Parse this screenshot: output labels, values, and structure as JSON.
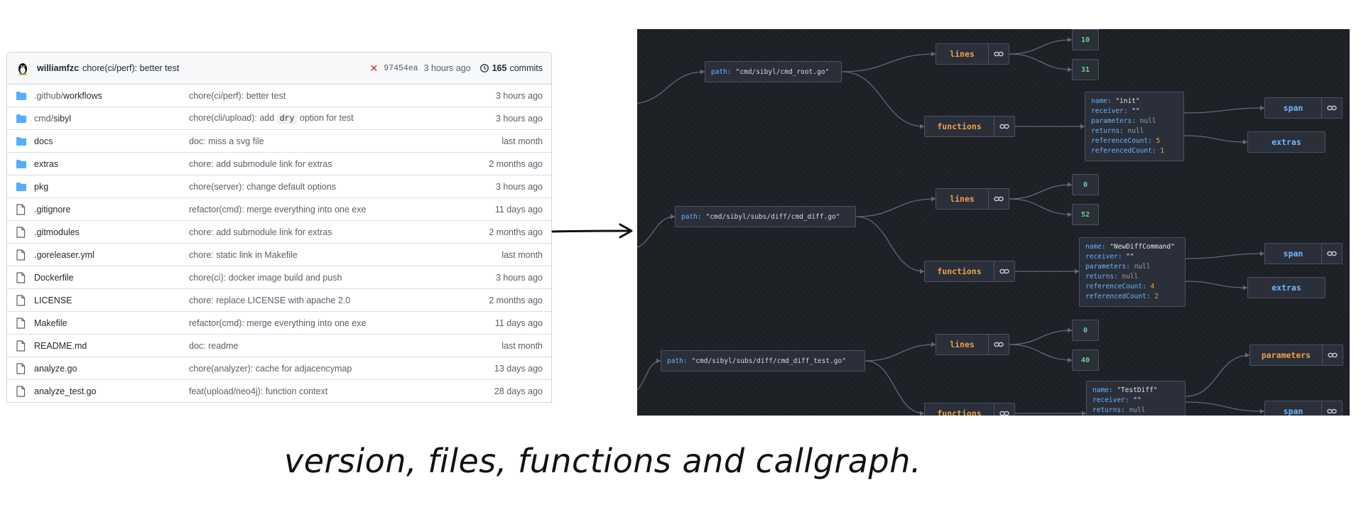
{
  "repo": {
    "latest_commit": {
      "author": "williamfzc",
      "message": "chore(ci/perf): better test",
      "status_icon": "x-icon",
      "sha": "97454ea",
      "time": "3 hours ago",
      "commits_count": "165",
      "commits_label": "commits"
    },
    "files": [
      {
        "type": "folder",
        "name_dim": ".github/",
        "name": "workflows",
        "message": "chore(ci/perf): better test",
        "time": "3 hours ago"
      },
      {
        "type": "folder",
        "name_dim": "cmd/",
        "name": "sibyl",
        "message": "chore(cli/upload): add ",
        "code": "dry",
        "message_after": " option for test",
        "time": "3 hours ago"
      },
      {
        "type": "folder",
        "name": "docs",
        "message": "doc: miss a svg file",
        "time": "last month"
      },
      {
        "type": "folder",
        "name": "extras",
        "message": "chore: add submodule link for extras",
        "time": "2 months ago"
      },
      {
        "type": "folder",
        "name": "pkg",
        "message": "chore(server): change default options",
        "time": "3 hours ago"
      },
      {
        "type": "file",
        "name": ".gitignore",
        "message": "refactor(cmd): merge everything into one exe",
        "time": "11 days ago"
      },
      {
        "type": "file",
        "name": ".gitmodules",
        "message": "chore: add submodule link for extras",
        "time": "2 months ago"
      },
      {
        "type": "file",
        "name": ".goreleaser.yml",
        "message": "chore: static link in Makefile",
        "time": "last month"
      },
      {
        "type": "file",
        "name": "Dockerfile",
        "message": "chore(ci): docker image build and push",
        "time": "3 hours ago"
      },
      {
        "type": "file",
        "name": "LICENSE",
        "message": "chore: replace LICENSE with apache 2.0",
        "time": "2 months ago"
      },
      {
        "type": "file",
        "name": "Makefile",
        "message": "refactor(cmd): merge everything into one exe",
        "time": "11 days ago"
      },
      {
        "type": "file",
        "name": "README.md",
        "message": "doc: readme",
        "time": "last month"
      },
      {
        "type": "file",
        "name": "analyze.go",
        "message": "chore(analyzer): cache for adjacencymap",
        "time": "13 days ago"
      },
      {
        "type": "file",
        "name": "analyze_test.go",
        "message": "feat(upload/neo4j): function context",
        "time": "28 days ago"
      }
    ]
  },
  "graph": {
    "path_key": "path:",
    "lines_label": "lines",
    "functions_label": "functions",
    "span_label": "span",
    "extras_label": "extras",
    "parameters_label": "parameters",
    "blocks": [
      {
        "path": "\"cmd/sibyl/cmd_root.go\"",
        "lines": [
          "10",
          "31"
        ],
        "fn": {
          "name": "\"init\"",
          "receiver": "\"\"",
          "parameters": "null",
          "returns": "null",
          "referenceCount": "5",
          "referencedCount": "1"
        }
      },
      {
        "path": "\"cmd/sibyl/subs/diff/cmd_diff.go\"",
        "lines": [
          "0",
          "52"
        ],
        "fn": {
          "name": "\"NewDiffCommand\"",
          "receiver": "\"\"",
          "parameters": "null",
          "returns": "null",
          "referenceCount": "4",
          "referencedCount": "2"
        }
      },
      {
        "path": "\"cmd/sibyl/subs/diff/cmd_diff_test.go\"",
        "lines": [
          "0",
          "40"
        ],
        "fn": {
          "name": "\"TestDiff\"",
          "receiver": "\"\"",
          "returns": "null"
        }
      }
    ],
    "field_keys": {
      "name": "name:",
      "receiver": "receiver:",
      "parameters": "parameters:",
      "returns": "returns:",
      "referenceCount": "referenceCount:",
      "referencedCount": "referencedCount:"
    }
  },
  "caption": "version, files, functions and callgraph."
}
